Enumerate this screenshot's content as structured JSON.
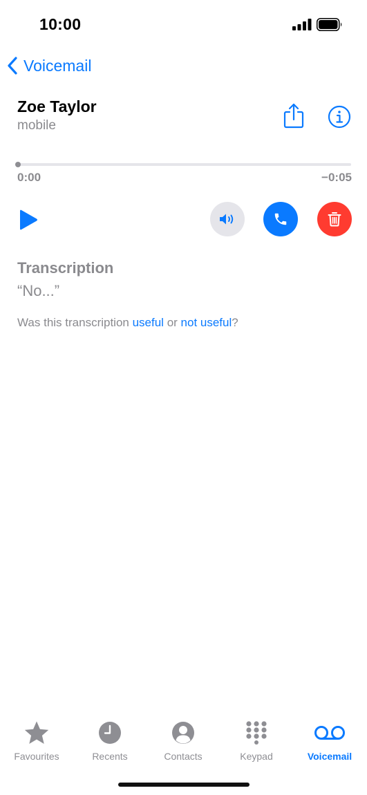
{
  "status_bar": {
    "time": "10:00"
  },
  "nav": {
    "back_label": "Voicemail"
  },
  "header": {
    "name": "Zoe Taylor",
    "subtitle": "mobile"
  },
  "player": {
    "elapsed": "0:00",
    "remaining": "−0:05",
    "progress": 0
  },
  "transcription": {
    "title": "Transcription",
    "text": "“No...”",
    "feedback_prefix": "Was this transcription ",
    "useful_link": "useful",
    "feedback_or": " or ",
    "not_useful_link": "not useful",
    "feedback_suffix": "?"
  },
  "tabbar": {
    "tabs": [
      {
        "label": "Favourites",
        "icon": "star-icon",
        "active": false
      },
      {
        "label": "Recents",
        "icon": "clock-icon",
        "active": false
      },
      {
        "label": "Contacts",
        "icon": "person-circle-icon",
        "active": false
      },
      {
        "label": "Keypad",
        "icon": "keypad-icon",
        "active": false
      },
      {
        "label": "Voicemail",
        "icon": "voicemail-icon",
        "active": true
      }
    ]
  },
  "colors": {
    "accent": "#0a7aff",
    "destructive": "#ff3b30",
    "secondary_text": "#8a8a8e"
  }
}
